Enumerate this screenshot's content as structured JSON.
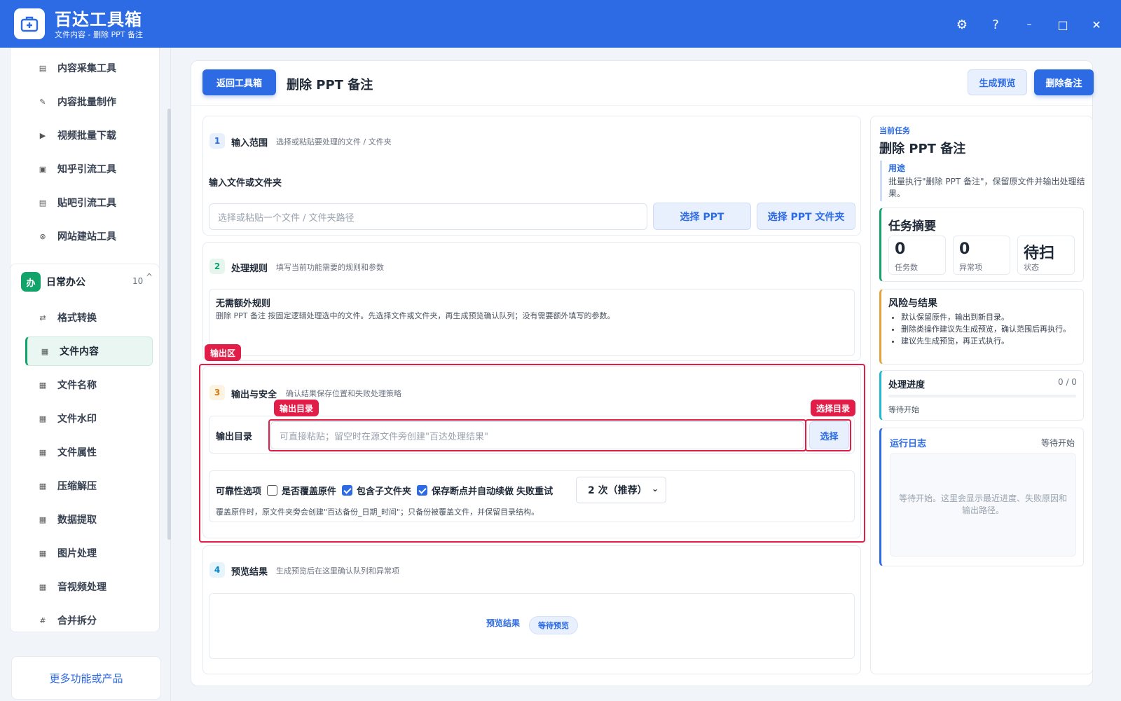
{
  "titlebar": {
    "title": "百达工具箱",
    "subtitle": "文件内容 - 删除 PPT 备注",
    "accent_color": "#2d6be4"
  },
  "window_controls": {
    "settings_icon": "⚙",
    "help_icon": "?",
    "minimize_icon": "–",
    "maximize_icon": "□",
    "close_icon": "✕"
  },
  "sidebar": {
    "group1_items": [
      {
        "label": "内容采集工具",
        "icon": "file-icon"
      },
      {
        "label": "内容批量制作",
        "icon": "pen-icon"
      },
      {
        "label": "视频批量下载",
        "icon": "video-icon"
      },
      {
        "label": "知乎引流工具",
        "icon": "zhihu-icon"
      },
      {
        "label": "贴吧引流工具",
        "icon": "tieba-icon"
      },
      {
        "label": "网站建站工具",
        "icon": "globe-icon"
      }
    ],
    "group2": {
      "badge": "办",
      "title": "日常办公",
      "count": "10",
      "chevron": "^",
      "items": [
        {
          "label": "格式转换",
          "icon": "swap-icon"
        },
        {
          "label": "文件内容",
          "icon": "grid-icon",
          "active": true
        },
        {
          "label": "文件名称",
          "icon": "grid-icon"
        },
        {
          "label": "文件水印",
          "icon": "grid-icon"
        },
        {
          "label": "文件属性",
          "icon": "grid-icon"
        },
        {
          "label": "压缩解压",
          "icon": "grid-icon"
        },
        {
          "label": "数据提取",
          "icon": "grid-icon"
        },
        {
          "label": "图片处理",
          "icon": "grid-icon"
        },
        {
          "label": "音视频处理",
          "icon": "grid-icon"
        },
        {
          "label": "合并拆分",
          "icon": "hash-icon"
        }
      ]
    },
    "more_button": "更多功能或产品"
  },
  "main": {
    "back_button": "返回工具箱",
    "page_title": "删除 PPT 备注",
    "preview_button": "生成预览",
    "delete_button": "删除备注",
    "sections": {
      "input": {
        "step": "1",
        "title": "输入范围",
        "desc": "选择或粘贴要处理的文件 / 文件夹",
        "field_label": "输入文件或文件夹",
        "placeholder": "选择或粘贴一个文件 / 文件夹路径",
        "select_ppt": "选择 PPT",
        "select_ppt_folder": "选择 PPT 文件夹"
      },
      "rules": {
        "step": "2",
        "title": "处理规则",
        "desc": "填写当前功能需要的规则和参数",
        "box_title": "无需额外规则",
        "box_desc": "删除 PPT 备注 按固定逻辑处理选中的文件。先选择文件或文件夹，再生成预览确认队列；没有需要额外填写的参数。"
      },
      "output": {
        "annot_label": "输出区",
        "step": "3",
        "title": "输出与安全",
        "desc": "确认结果保存位置和失败处理策略",
        "dir_label": "输出目录",
        "dir_annot": "输出目录",
        "dir_placeholder": "可直接粘贴；留空时在源文件旁创建\"百达处理结果\"",
        "select_annot": "选择目录",
        "select_button": "选择",
        "reliability_label": "可靠性选项",
        "opt_overwrite": "是否覆盖原件",
        "opt_subfolders": "包含子文件夹",
        "opt_resume": "保存断点并自动续做",
        "retry_label": "失败重试",
        "retry_value": "2 次（推荐）",
        "note": "覆盖原件时，原文件夹旁会创建\"百达备份_日期_时间\"；只备份被覆盖文件，并保留目录结构。"
      },
      "preview": {
        "step": "4",
        "title": "预览结果",
        "desc": "生成预览后在这里确认队列和异常项",
        "result_label": "预览结果",
        "result_badge": "等待预览"
      }
    }
  },
  "right": {
    "current_task_label": "当前任务",
    "task_title": "删除 PPT 备注",
    "purpose_label": "用途",
    "purpose_text": "批量执行\"删除 PPT 备注\"，保留原文件并输出处理结果。",
    "summary_title": "任务摘要",
    "stats": [
      {
        "value": "0",
        "label": "任务数"
      },
      {
        "value": "0",
        "label": "异常项"
      },
      {
        "value": "待扫",
        "label": "状态"
      }
    ],
    "risk_title": "风险与结果",
    "risk_items": [
      "默认保留原件，输出到新目录。",
      "删除类操作建议先生成预览，确认范围后再执行。",
      "建议先生成预览，再正式执行。"
    ],
    "progress_title": "处理进度",
    "progress_count": "0 / 0",
    "progress_value": 0,
    "progress_status": "等待开始",
    "log_title": "运行日志",
    "log_status": "等待开始",
    "log_placeholder": "等待开始。这里会显示最近进度、失败原因和输出路径。"
  }
}
